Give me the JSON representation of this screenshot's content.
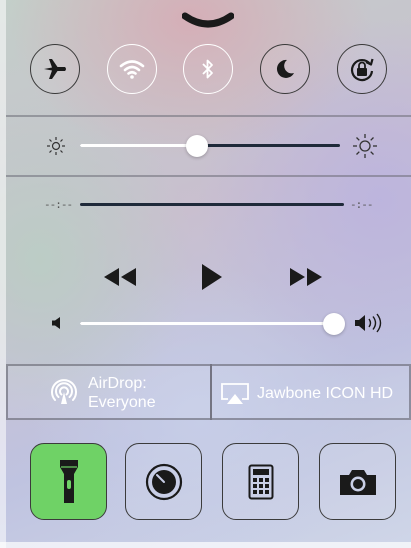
{
  "control_center": {
    "grabber": {
      "icon": "chevron-down-icon"
    },
    "toggles": [
      {
        "name": "Airplane Mode",
        "icon": "airplane-icon",
        "state": "off"
      },
      {
        "name": "Wi-Fi",
        "icon": "wifi-icon",
        "state": "on"
      },
      {
        "name": "Bluetooth",
        "icon": "bluetooth-icon",
        "state": "on"
      },
      {
        "name": "Do Not Disturb",
        "icon": "moon-icon",
        "state": "off"
      },
      {
        "name": "Rotation Lock",
        "icon": "rotation-lock-icon",
        "state": "off"
      }
    ],
    "brightness": {
      "level": 0.45,
      "min_icon": "sun-small-icon",
      "max_icon": "sun-large-icon"
    },
    "playback": {
      "elapsed": "--:--",
      "remaining": "-:--",
      "buttons": [
        "rewind-icon",
        "play-icon",
        "fast-forward-icon"
      ]
    },
    "volume": {
      "level": 1.0,
      "min_icon": "speaker-low-icon",
      "max_icon": "speaker-high-icon"
    },
    "sharing": {
      "airdrop": {
        "line1": "AirDrop:",
        "line2": "Everyone",
        "icon": "airdrop-icon"
      },
      "airplay": {
        "label": "Jawbone ICON HD",
        "icon": "airplay-icon"
      }
    },
    "tools": [
      {
        "name": "Flashlight",
        "icon": "flashlight-icon",
        "state": "on"
      },
      {
        "name": "Timer",
        "icon": "timer-icon",
        "state": "off"
      },
      {
        "name": "Calculator",
        "icon": "calculator-icon",
        "state": "off"
      },
      {
        "name": "Camera",
        "icon": "camera-icon",
        "state": "off"
      }
    ],
    "colors": {
      "active_toggle": "#ffffff",
      "flashlight_on": "#6fd266",
      "track_filled": "#ffffff",
      "track_empty": "#1f2a3a"
    }
  }
}
